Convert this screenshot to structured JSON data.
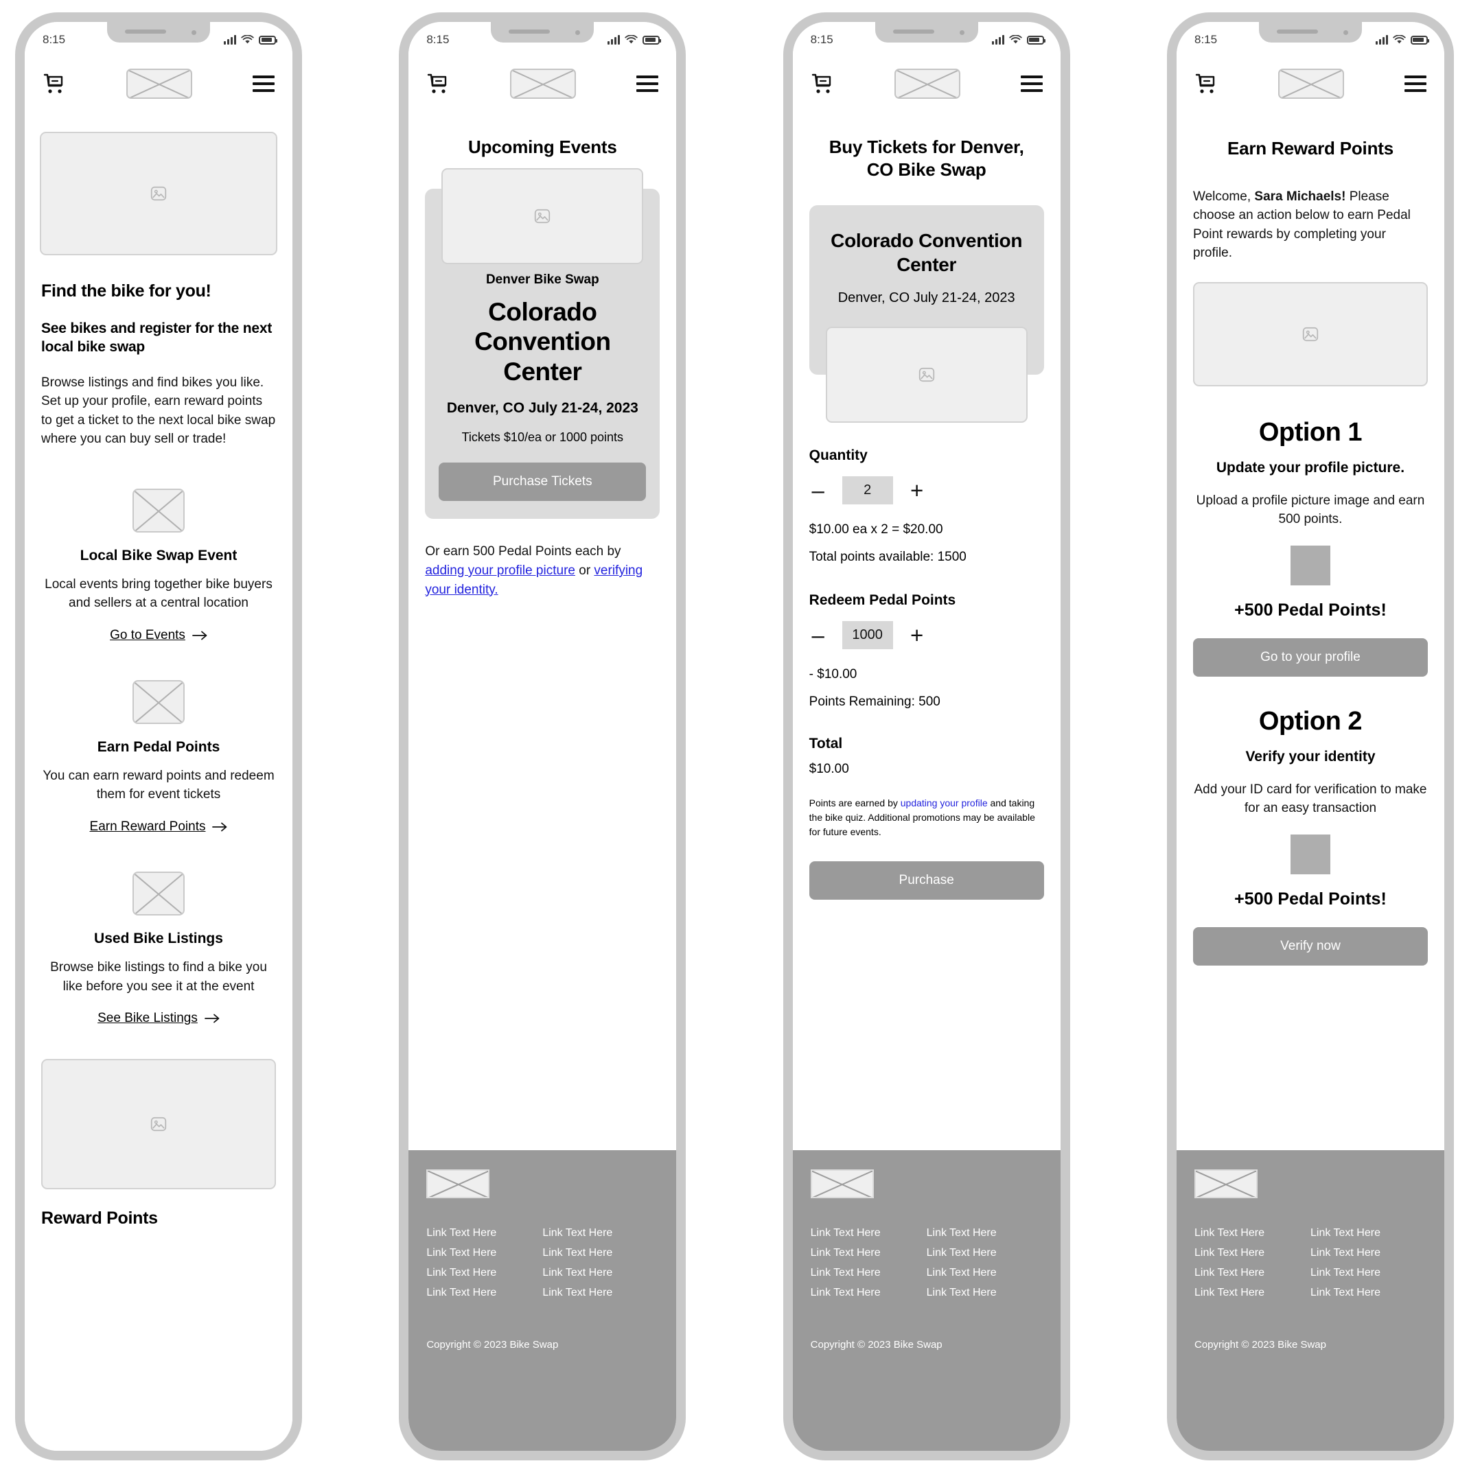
{
  "status": {
    "time": "8:15"
  },
  "header": {
    "cart_icon": "shopping-cart-icon",
    "logo": "brand-logo-placeholder",
    "menu_icon": "hamburger-menu-icon"
  },
  "footer": {
    "links_left": [
      "Link Text Here",
      "Link Text Here",
      "Link Text Here",
      "Link Text Here"
    ],
    "links_right": [
      "Link Text Here",
      "Link Text Here",
      "Link Text Here",
      "Link Text Here"
    ],
    "copyright": "Copyright © 2023 Bike Swap"
  },
  "screen1": {
    "h1": "Find the bike for you!",
    "h2": "See bikes and register for the next local bike swap",
    "body": "Browse listings and find bikes you like. Set up your profile, earn reward points to get a ticket to the next local bike swap where you can buy sell or trade!",
    "features": [
      {
        "title": "Local Bike Swap Event",
        "desc": "Local events bring together bike buyers and sellers at a central location",
        "link": "Go to Events"
      },
      {
        "title": "Earn Pedal Points",
        "desc": "You can earn reward points and redeem them for event tickets",
        "link": "Earn Reward Points"
      },
      {
        "title": "Used Bike Listings",
        "desc": "Browse bike listings to find a bike you like before you see it at the event",
        "link": "See Bike Listings"
      }
    ],
    "bottom_heading": "Reward Points"
  },
  "screen2": {
    "title": "Upcoming Events",
    "card": {
      "eyebrow": "Denver Bike Swap",
      "venue": "Colorado Convention Center",
      "location": "Denver, CO July 21-24, 2023",
      "price": "Tickets $10/ea or 1000 points",
      "cta": "Purchase Tickets"
    },
    "note_prefix": "Or earn 500 Pedal Points each by ",
    "note_link1": "adding your profile picture",
    "note_mid": " or ",
    "note_link2": "verifying your identity."
  },
  "screen3": {
    "title": "Buy Tickets for Denver, CO Bike Swap",
    "venue": "Colorado Convention Center",
    "location": "Denver, CO July 21-24, 2023",
    "quantity_label": "Quantity",
    "quantity_value": "2",
    "price_calc": "$10.00 ea x 2 = $20.00",
    "points_available": "Total points available: 1500",
    "redeem_label": "Redeem Pedal Points",
    "redeem_value": "1000",
    "redeem_discount": "- $10.00",
    "points_remaining": "Points Remaining: 500",
    "total_label": "Total",
    "total_value": "$10.00",
    "fineprint_a": "Points are earned by ",
    "fineprint_link": "updating your profile",
    "fineprint_b": " and taking the bike quiz. Additional promotions may be available for future events.",
    "cta": "Purchase",
    "minus": "–",
    "plus": "+"
  },
  "screen4": {
    "title": "Earn Reward Points",
    "welcome_a": "Welcome, ",
    "welcome_name": "Sara Michaels!",
    "welcome_b": " Please choose an action below to earn Pedal Point rewards by completing your profile.",
    "options": [
      {
        "heading": "Option 1",
        "sub": "Update your profile picture.",
        "desc": "Upload a profile picture image and earn 500 points.",
        "points": "+500 Pedal Points!",
        "cta": "Go to your profile"
      },
      {
        "heading": "Option 2",
        "sub": "Verify your identity",
        "desc": "Add your ID card for verification to make for an easy transaction",
        "points": "+500 Pedal Points!",
        "cta": "Verify now"
      }
    ]
  }
}
